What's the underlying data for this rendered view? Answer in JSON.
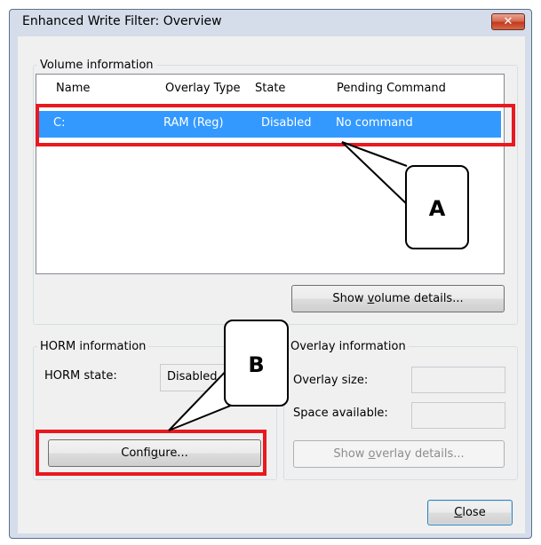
{
  "window": {
    "title": "Enhanced Write Filter: Overview",
    "close_glyph": "✕"
  },
  "volume": {
    "legend": "Volume information",
    "columns": [
      "Name",
      "Overlay Type",
      "State",
      "Pending Command"
    ],
    "rows": [
      {
        "name": "C:",
        "overlay_type": "RAM (Reg)",
        "state": "Disabled",
        "pending_command": "No command"
      }
    ],
    "details_button": {
      "pre": "Show ",
      "accel": "v",
      "post": "olume details..."
    }
  },
  "horm": {
    "legend": "HORM information",
    "state_label": "HORM state:",
    "state_value": "Disabled",
    "configure_button": {
      "pre": "Confi",
      "accel": "g",
      "post": "ure..."
    }
  },
  "overlay": {
    "legend": "Overlay information",
    "size_label": "Overlay size:",
    "size_value": "",
    "space_label": "Space available:",
    "space_value": "",
    "details_button": {
      "pre": "Show ",
      "accel": "o",
      "post": "verlay details..."
    }
  },
  "close_button": {
    "pre": "",
    "accel": "C",
    "post": "lose"
  },
  "annotations": {
    "callout_a": "A",
    "callout_b": "B",
    "highlight_color": "#e8191f"
  },
  "colors": {
    "selection": "#3399ff",
    "title_close": "#c23a20"
  }
}
